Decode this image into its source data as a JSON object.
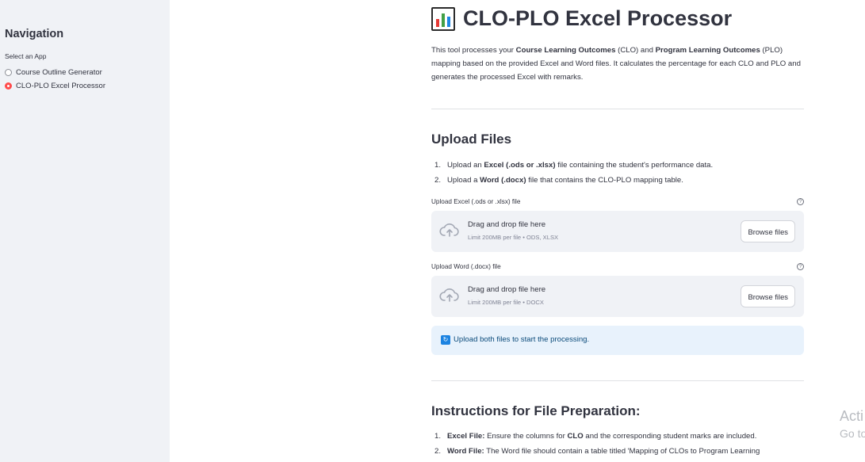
{
  "sidebar": {
    "title": "Navigation",
    "select_label": "Select an App",
    "options": [
      {
        "label": "Course Outline Generator",
        "selected": false
      },
      {
        "label": "CLO-PLO Excel Processor",
        "selected": true
      }
    ]
  },
  "main": {
    "title": "CLO-PLO Excel Processor",
    "title_icon": "bar-chart-emoji",
    "intro": {
      "p1": "This tool processes your ",
      "b1": "Course Learning Outcomes",
      "p2": " (CLO) and ",
      "b2": "Program Learning Outcomes",
      "p3": " (PLO) mapping based on the provided Excel and Word files. It calculates the percentage for each CLO and PLO and generates the processed Excel with remarks."
    },
    "upload_heading": "Upload Files",
    "upload_steps": [
      {
        "num": "1.",
        "pre": "Upload an ",
        "bold": "Excel (.ods or .xlsx)",
        "post": " file containing the student's performance data."
      },
      {
        "num": "2.",
        "pre": "Upload a ",
        "bold": "Word (.docx)",
        "post": " file that contains the CLO-PLO mapping table."
      }
    ],
    "uploaders": [
      {
        "label": "Upload Excel (.ods or .xlsx) file",
        "drag_text": "Drag and drop file here",
        "limit": "Limit 200MB per file • ODS, XLSX",
        "button": "Browse files"
      },
      {
        "label": "Upload Word (.docx) file",
        "drag_text": "Drag and drop file here",
        "limit": "Limit 200MB per file • DOCX",
        "button": "Browse files"
      }
    ],
    "info_message": "Upload both files to start the processing.",
    "instructions_heading": "Instructions for File Preparation:",
    "instructions": [
      {
        "num": "1.",
        "bold": "Excel File:",
        "post": " Ensure the columns for ",
        "bold2": "CLO",
        "post2": " and the corresponding student marks are included."
      },
      {
        "num": "2.",
        "bold": "Word File:",
        "post": " The Word file should contain a table titled 'Mapping of CLOs to Program Learning",
        "bold2": "",
        "post2": ""
      }
    ]
  },
  "watermark": {
    "line1": "Acti",
    "line2": "Go to"
  },
  "colors": {
    "sidebar_bg": "#f0f2f6",
    "accent_radio": "#ff4b4b",
    "info_bg": "#e8f2fc",
    "info_text": "#0a4a7a",
    "dropzone_bg": "#f0f2f6"
  }
}
